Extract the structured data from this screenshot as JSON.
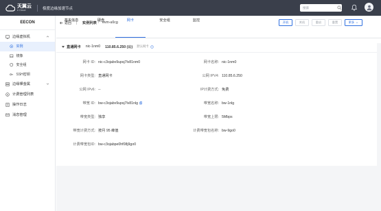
{
  "topbar": {
    "brand": "天翼云",
    "brand_sub": "e Cloud",
    "project": "极度边缘加速节点",
    "search_placeholder": "搜索"
  },
  "sidebar": {
    "title": "EECON",
    "groups": [
      {
        "label": "边缘虚拟机",
        "icon": "vm-icon",
        "expanded": true,
        "children": [
          {
            "label": "实例",
            "icon": "instance-icon",
            "active": true
          },
          {
            "label": "镜像",
            "icon": "image-icon",
            "active": false
          },
          {
            "label": "安全组",
            "icon": "shield-icon",
            "active": false
          },
          {
            "label": "SSH密钥",
            "icon": "key-icon",
            "active": false
          }
        ]
      },
      {
        "label": "边缘裸金属",
        "icon": "server-icon",
        "expanded": false
      },
      {
        "label": "计费管理列表",
        "icon": "billing-icon",
        "expanded": false
      },
      {
        "label": "操作日志",
        "icon": "log-icon",
        "expanded": false
      },
      {
        "label": "消息管理",
        "icon": "message-icon",
        "expanded": false
      }
    ]
  },
  "header": {
    "back_label": "返回",
    "breadcrumb_list": "实例列表",
    "breadcrumb_sep": "/",
    "breadcrumb_current": "evm-u0cg",
    "buttons": {
      "start": "开机",
      "shutdown": "关机",
      "restart": "重启",
      "reset": "重置",
      "more": "更多"
    }
  },
  "tabs": {
    "items": [
      "基本信息",
      "硬盘",
      "网卡",
      "安全组",
      "监控"
    ],
    "active_index": 2
  },
  "nic": {
    "type": "直通网卡",
    "name": "nic-1nm0",
    "ip": "110.85.6.250 (公)",
    "default_label": "默认网卡"
  },
  "fields": [
    {
      "label": "网卡 ID:",
      "value": "nic-c3ojabv9upsj7lv81nm0"
    },
    {
      "label": "网卡名称:",
      "value": "nic-1nm0"
    },
    {
      "label": "网卡类型:",
      "value": "直通网卡"
    },
    {
      "label": "公网 IPV4:",
      "value": "110.85.6.250"
    },
    {
      "label": "公网 IPv6:",
      "value": "--"
    },
    {
      "label": "IP计费方式:",
      "value": "免费"
    },
    {
      "label": "带宽 ID:",
      "value": "bw-c3ojabv9upsj7lv81nlg"
    },
    {
      "label": "带宽名称:",
      "value": "bw-1nlg"
    },
    {
      "label": "带宽类型:",
      "value": "独享"
    },
    {
      "label": "带宽上限:",
      "value": "5Mbps"
    },
    {
      "label": "带宽计费方式:",
      "value": "按月 95 峰值"
    },
    {
      "label": "计费带宽包名称:",
      "value": "bw-9go0"
    },
    {
      "label": "计费带宽包ID:",
      "value": "bw-c3ojabpe0hf08j9go0"
    }
  ],
  "colors": {
    "topbar": "#3a3f4b",
    "accent": "#2e6fe0",
    "page_bg": "#f4f5f7"
  }
}
